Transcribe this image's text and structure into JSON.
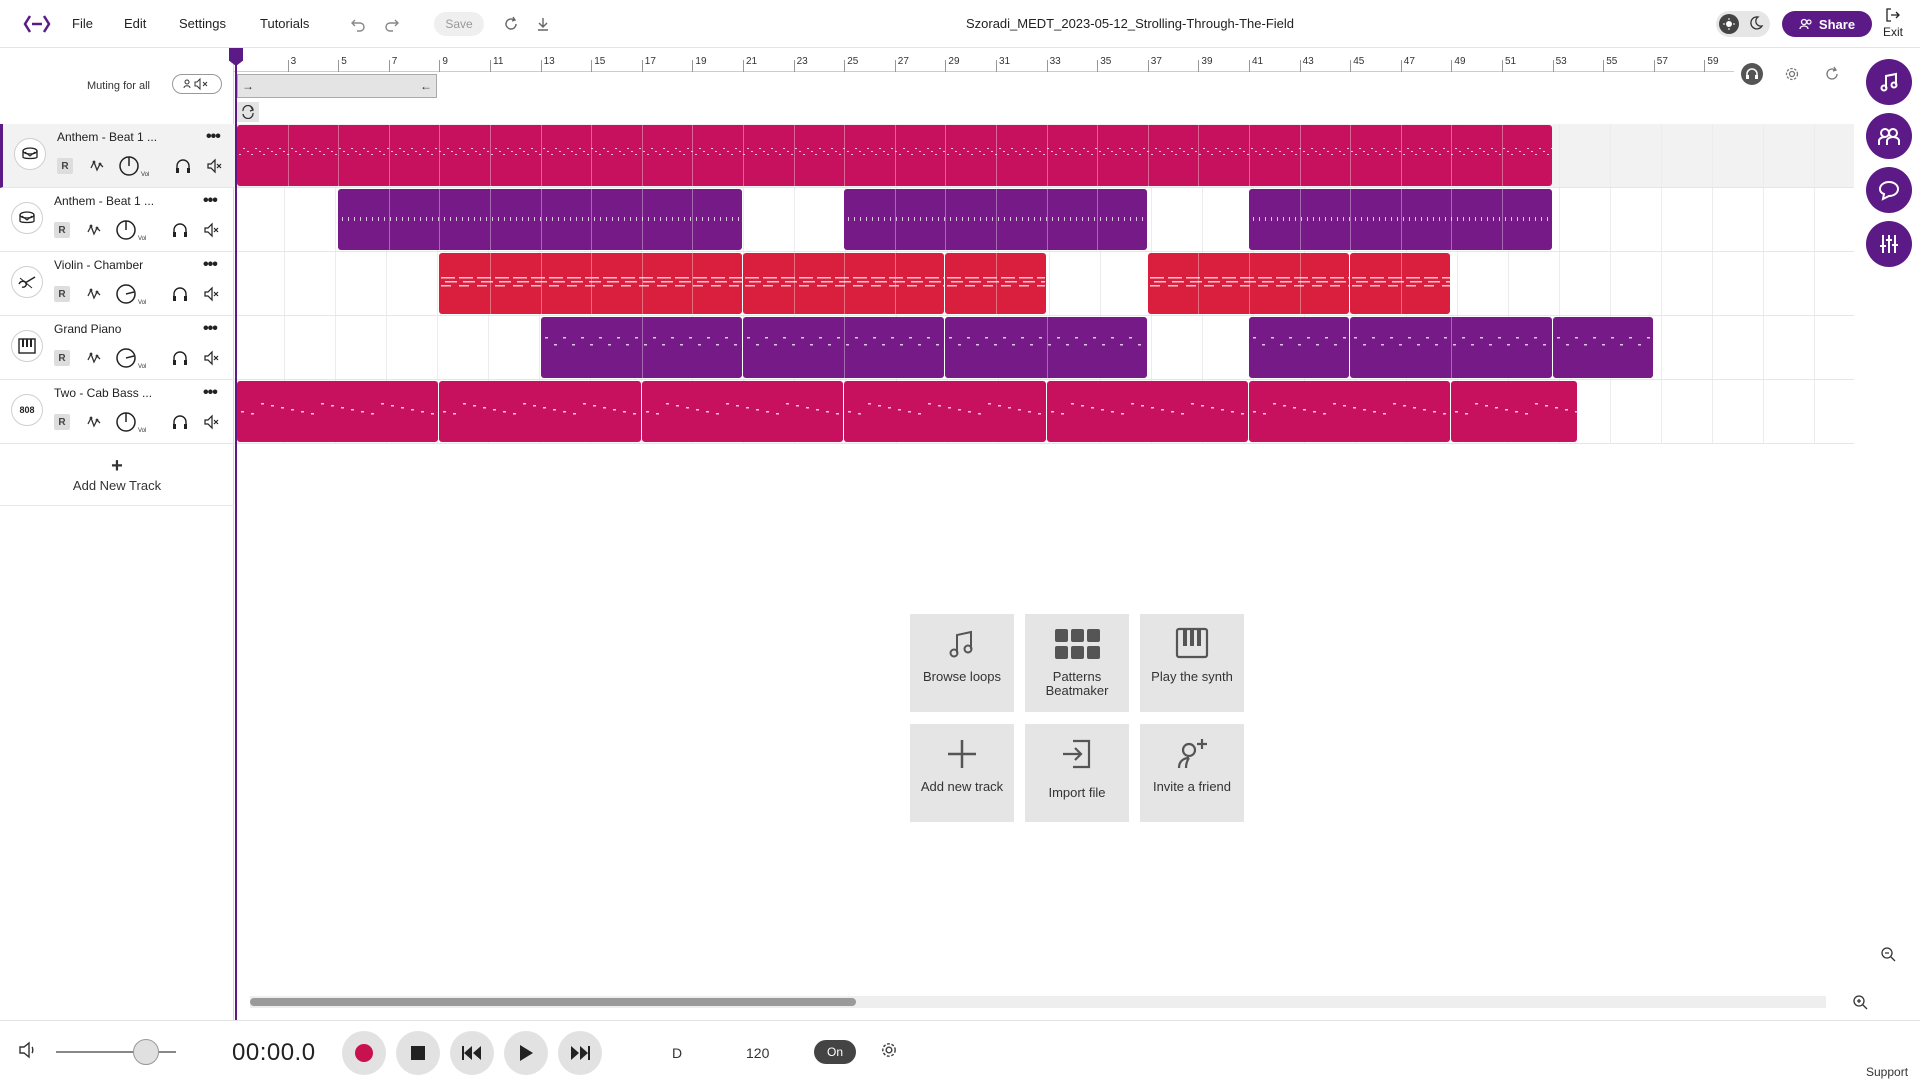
{
  "app": {
    "menu": [
      "File",
      "Edit",
      "Settings",
      "Tutorials"
    ],
    "save_label": "Save",
    "project_title": "Szoradi_MEDT_2023-05-12_Strolling-Through-The-Field",
    "share_label": "Share",
    "exit_label": "Exit"
  },
  "mixer": {
    "muting_label": "Muting for all"
  },
  "ruler": {
    "bars": [
      "3",
      "5",
      "7",
      "9",
      "11",
      "13",
      "15",
      "17",
      "19",
      "21",
      "23",
      "25",
      "27",
      "29",
      "31",
      "33",
      "35",
      "37",
      "39",
      "41",
      "43",
      "45",
      "47",
      "49",
      "51",
      "53",
      "55",
      "57",
      "59"
    ]
  },
  "tracks": [
    {
      "name": "Anthem - Beat 1 ...",
      "icon": "drum-icon",
      "selected": true,
      "rec": "R",
      "vol_label": "Vol",
      "color": "#c8115e"
    },
    {
      "name": "Anthem - Beat 1 ...",
      "icon": "drum-icon",
      "selected": false,
      "rec": "R",
      "vol_label": "Vol",
      "color": "#751a86"
    },
    {
      "name": "Violin - Chamber",
      "icon": "violin-icon",
      "selected": false,
      "rec": "R",
      "vol_label": "Vol",
      "color": "#d91f3d"
    },
    {
      "name": "Grand Piano",
      "icon": "piano-icon",
      "selected": false,
      "rec": "R",
      "vol_label": "Vol",
      "color": "#751a86"
    },
    {
      "name": "Two - Cab Bass ...",
      "icon": "808-icon",
      "icon_text": "808",
      "selected": false,
      "rec": "R",
      "vol_label": "Vol",
      "color": "#c8115e"
    }
  ],
  "add_track_label": "Add New Track",
  "quick_actions": [
    {
      "label": "Browse loops",
      "icon": "music-note-icon"
    },
    {
      "label": "Patterns Beatmaker",
      "icon": "patterns-grid-icon"
    },
    {
      "label": "Play the synth",
      "icon": "synth-keys-icon"
    },
    {
      "label": "Add new track",
      "icon": "plus-icon"
    },
    {
      "label": "Import file",
      "icon": "import-icon"
    },
    {
      "label": "Invite a friend",
      "icon": "invite-user-icon"
    }
  ],
  "side_buttons": [
    "sounds-icon",
    "collaborators-icon",
    "chat-icon",
    "mixer-icon"
  ],
  "transport": {
    "time": "00:00.0",
    "key": "D",
    "bpm": "120",
    "metronome": "On",
    "support_label": "Support",
    "volume_level": 0.75
  },
  "colors": {
    "accent": "#5b1a86",
    "pink_clip": "#c8115e",
    "purple_clip": "#751a86",
    "red_clip": "#d91f3d"
  }
}
